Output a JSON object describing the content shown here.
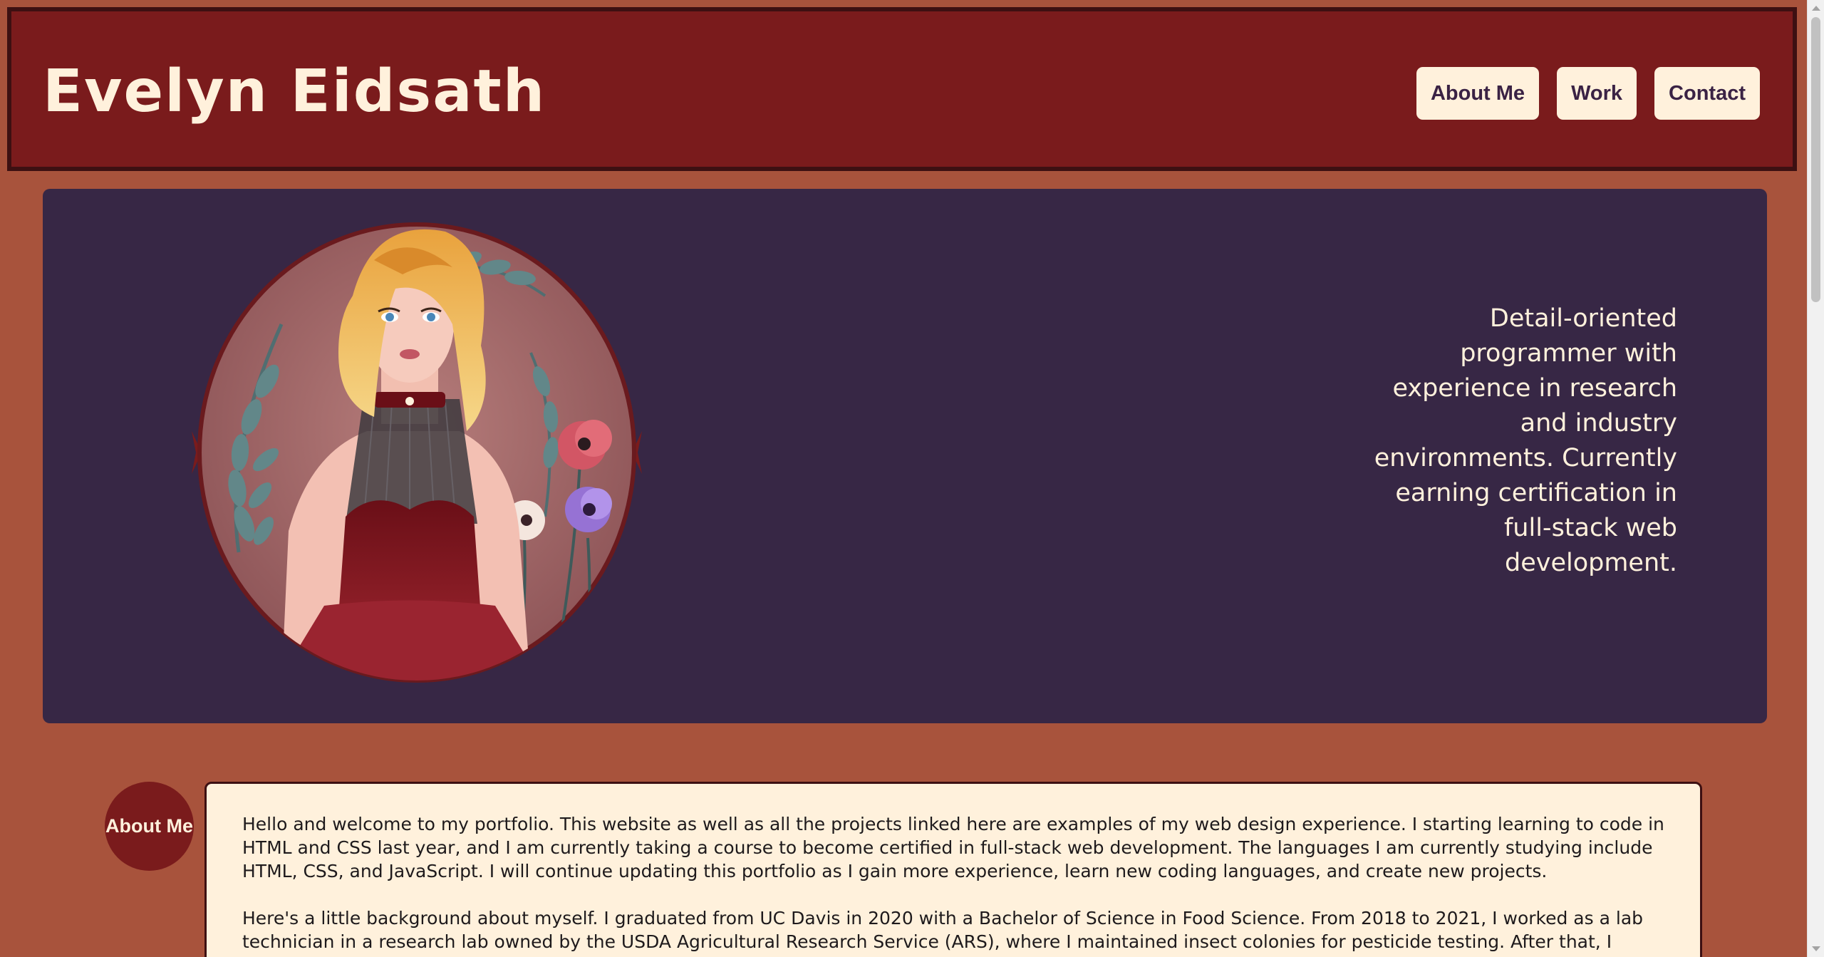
{
  "header": {
    "title": "Evelyn Eidsath",
    "nav": [
      {
        "label": "About Me"
      },
      {
        "label": "Work"
      },
      {
        "label": "Contact"
      }
    ]
  },
  "hero": {
    "portrait_alt": "illustrated portrait",
    "tagline": "Detail-oriented programmer with experience in research and industry environments. Currently earning certification in full-stack web development."
  },
  "about": {
    "heading": "About Me",
    "paragraphs": [
      "Hello and welcome to my portfolio. This website as well as all the projects linked here are examples of my web design experience. I starting learning to code in HTML and CSS last year, and I am currently taking a course to become certified in full-stack web development. The languages I am currently studying include HTML, CSS, and JavaScript. I will continue updating this portfolio as I gain more experience, learn new coding languages, and create new projects.",
      "Here's a little background about myself. I graduated from UC Davis in 2020 with a Bachelor of Science in Food Science. From 2018 to 2021, I worked as a lab technician in a research lab owned by the USDA Agricultural Research Service (ARS), where I maintained insect colonies for pesticide testing. After that, I worked as a Quality Assurance Technician for Kerry"
    ]
  },
  "colors": {
    "page_bg": "#a8533c",
    "header_bg": "#7a1b1c",
    "hero_bg": "#372745",
    "cream": "#fff1dc",
    "nav_text": "#3a2244"
  }
}
